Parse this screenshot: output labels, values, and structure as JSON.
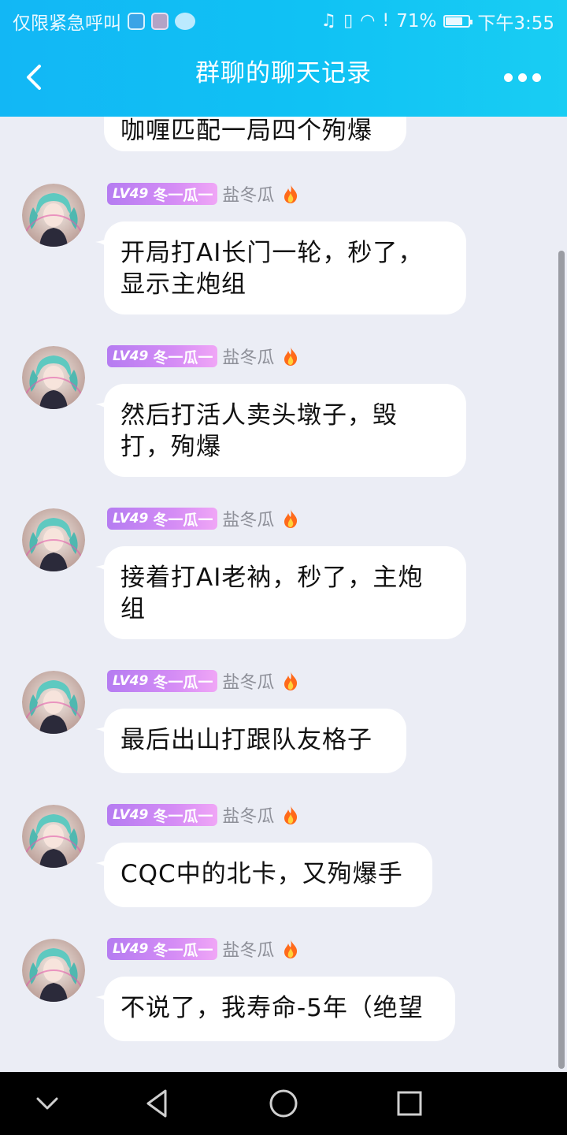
{
  "status_bar": {
    "carrier": "仅限紧急呼叫",
    "battery": "71%",
    "time": "下午3:55"
  },
  "header": {
    "title": "群聊的聊天记录",
    "back_icon": "chevron-left-icon",
    "more_icon": "more-dots-icon"
  },
  "partial_message": {
    "text": "咖喱匹配一局四个殉爆"
  },
  "messages": [
    {
      "level": "LV49",
      "title_badge": "冬一瓜一",
      "sender": "盐冬瓜",
      "text_lines": [
        "开局打AI长门一轮，秒了，",
        "显示主炮组"
      ]
    },
    {
      "level": "LV49",
      "title_badge": "冬一瓜一",
      "sender": "盐冬瓜",
      "text_lines": [
        "然后打活人卖头墩子，毁",
        "打，殉爆"
      ]
    },
    {
      "level": "LV49",
      "title_badge": "冬一瓜一",
      "sender": "盐冬瓜",
      "text_lines": [
        "接着打AI老衲，秒了，主炮",
        "组"
      ]
    },
    {
      "level": "LV49",
      "title_badge": "冬一瓜一",
      "sender": "盐冬瓜",
      "text_lines": [
        "最后出山打跟队友格子"
      ]
    },
    {
      "level": "LV49",
      "title_badge": "冬一瓜一",
      "sender": "盐冬瓜",
      "text_lines": [
        "CQC中的北卡，又殉爆手"
      ]
    },
    {
      "level": "LV49",
      "title_badge": "冬一瓜一",
      "sender": "盐冬瓜",
      "text_lines": [
        "不说了，我寿命-5年（绝望"
      ]
    }
  ],
  "nav_bar": {
    "icons": [
      "chevron-down-icon",
      "back-triangle-icon",
      "home-circle-icon",
      "recents-square-icon"
    ]
  },
  "colors": {
    "header": "#12b7f5",
    "background": "#ebedf5",
    "level_badge": "#c584f3",
    "sender_text": "#8e9099"
  }
}
